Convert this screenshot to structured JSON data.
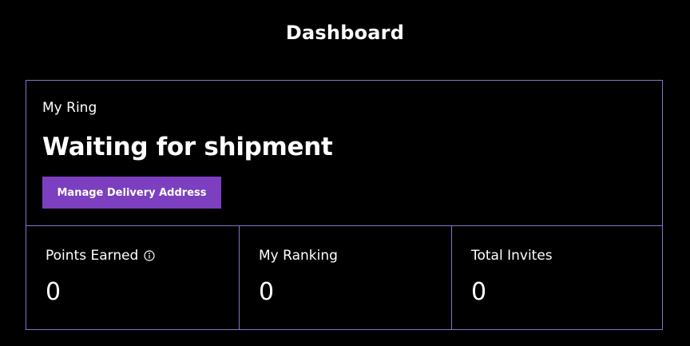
{
  "header": {
    "title": "Dashboard"
  },
  "ring": {
    "label": "My Ring",
    "status": "Waiting for shipment",
    "button_label": "Manage Delivery Address"
  },
  "stats": [
    {
      "label": "Points Earned",
      "value": "0",
      "icon": "info-icon"
    },
    {
      "label": "My Ranking",
      "value": "0"
    },
    {
      "label": "Total Invites",
      "value": "0"
    }
  ],
  "colors": {
    "background": "#000000",
    "border": "#8a70c9",
    "button": "#7b3fbf",
    "text": "#ffffff"
  }
}
